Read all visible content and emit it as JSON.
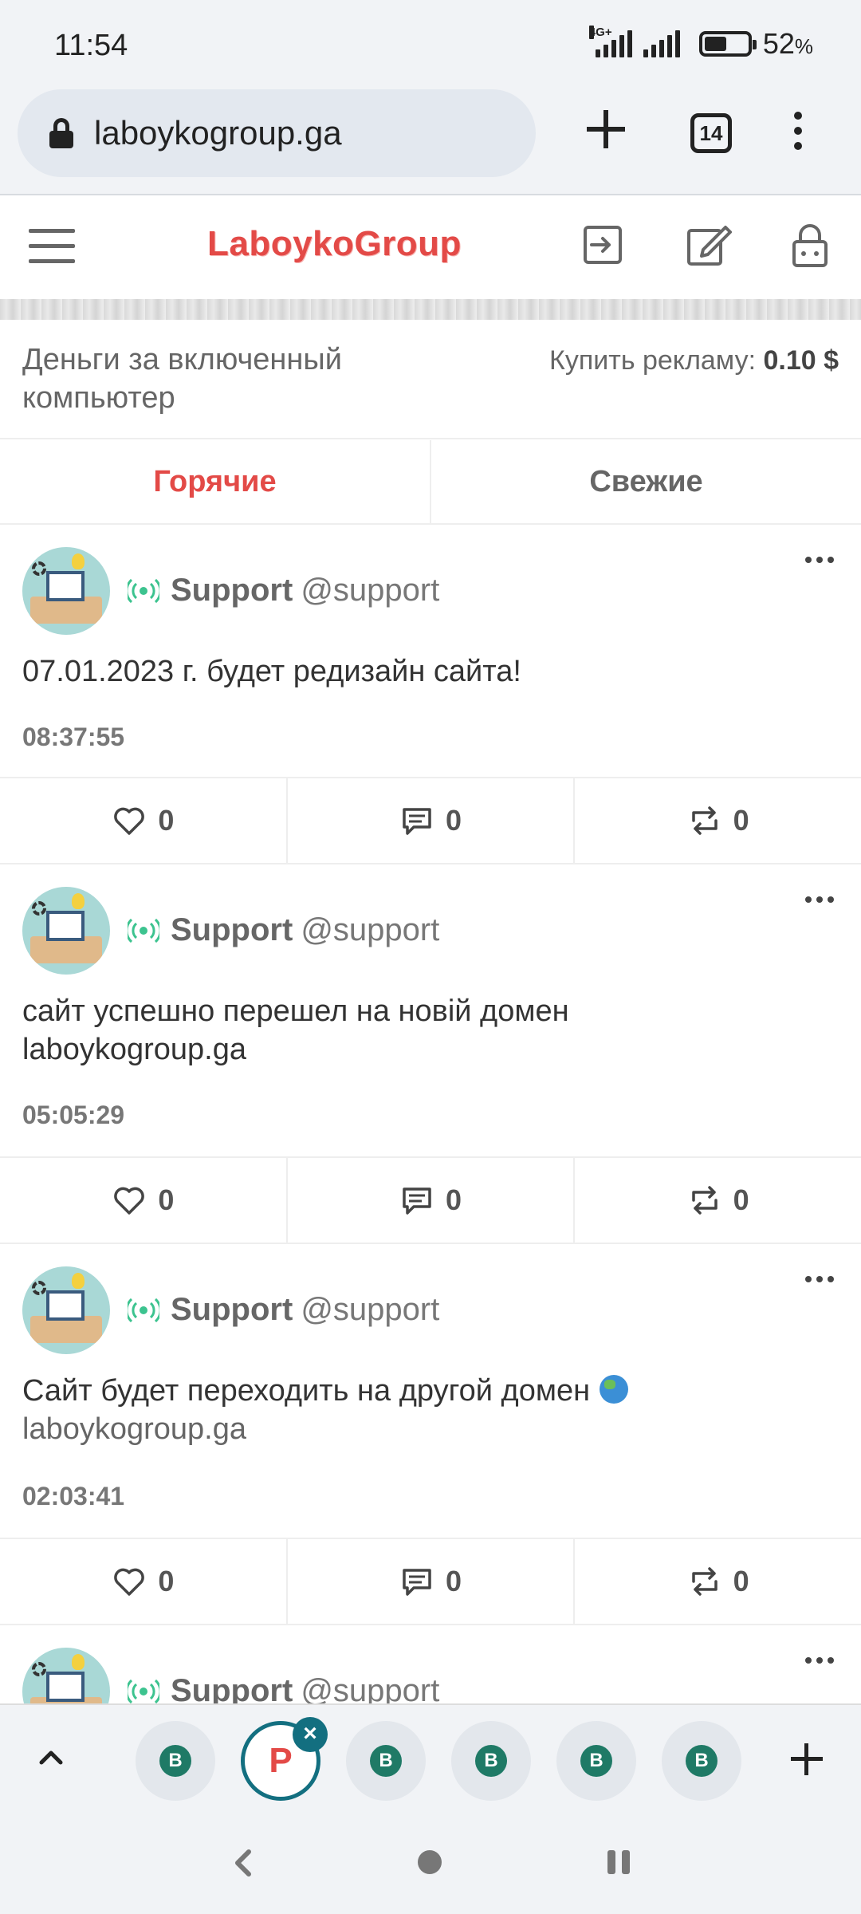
{
  "status_bar": {
    "time": "11:54",
    "network": "4G+",
    "battery_percent": "52",
    "battery_sign": "%",
    "battery_level": 0.52
  },
  "browser": {
    "url": "laboykogroup.ga",
    "tab_count": "14"
  },
  "site": {
    "logo": "LaboykoGroup",
    "brand_color": "#e34a47",
    "info_left": "Деньги за включенный компьютер",
    "info_right_label": "Купить рекламу:",
    "info_right_value": "0.10 $",
    "tabs": [
      {
        "label": "Горячие",
        "active": true
      },
      {
        "label": "Свежие",
        "active": false
      }
    ]
  },
  "posts": [
    {
      "name": "Support",
      "handle": "@support",
      "text": "07.01.2023 г. будет редизайн сайта!",
      "link": "",
      "time": "08:37:55",
      "likes": "0",
      "comments": "0",
      "reposts": "0"
    },
    {
      "name": "Support",
      "handle": "@support",
      "text": "сайт успешно перешел на новій домен laboykogroup.ga",
      "link": "",
      "time": "05:05:29",
      "likes": "0",
      "comments": "0",
      "reposts": "0"
    },
    {
      "name": "Support",
      "handle": "@support",
      "text": "Сайт будет переходить на другой домен",
      "link": "laboykogroup.ga",
      "time": "02:03:41",
      "likes": "0",
      "comments": "0",
      "reposts": "0"
    },
    {
      "name": "Support",
      "handle": "@support"
    }
  ],
  "tab_strip": {
    "favicon_b": "B",
    "favicon_p": "P",
    "close": "×"
  },
  "icons": {
    "lock": "lock-icon",
    "login": "login-icon",
    "edit": "edit-icon",
    "padlock": "padlock-icon",
    "live": "live-broadcast-icon",
    "like": "heart-icon",
    "comment": "comment-icon",
    "repost": "repost-icon"
  }
}
